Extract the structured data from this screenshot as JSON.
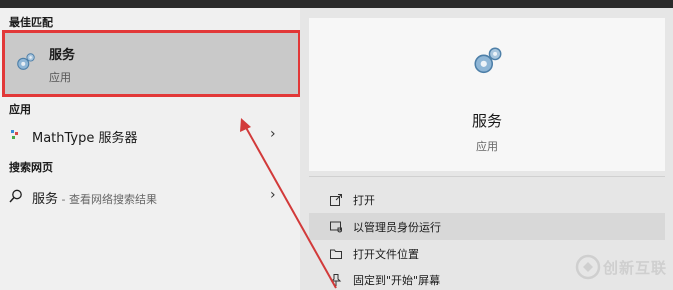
{
  "sections": {
    "best_match": "最佳匹配",
    "apps": "应用",
    "web_search": "搜索网页"
  },
  "best_match": {
    "name": "服务",
    "type": "应用"
  },
  "apps": [
    {
      "name": "MathType 服务器",
      "icon": "mathtype-icon"
    }
  ],
  "web_search": {
    "query": "服务",
    "suffix": " - 查看网络搜索结果"
  },
  "detail": {
    "name": "服务",
    "type": "应用"
  },
  "actions": [
    {
      "label": "打开",
      "icon": "open-icon"
    },
    {
      "label": "以管理员身份运行",
      "icon": "shield-icon"
    },
    {
      "label": "打开文件位置",
      "icon": "folder-icon"
    },
    {
      "label": "固定到\"开始\"屏幕",
      "icon": "pin-icon"
    }
  ],
  "watermark": {
    "text": "创新互联"
  },
  "colors": {
    "highlight_border": "#e23838",
    "arrow": "#d23a3a",
    "selected_bg": "#c9c9c9"
  }
}
